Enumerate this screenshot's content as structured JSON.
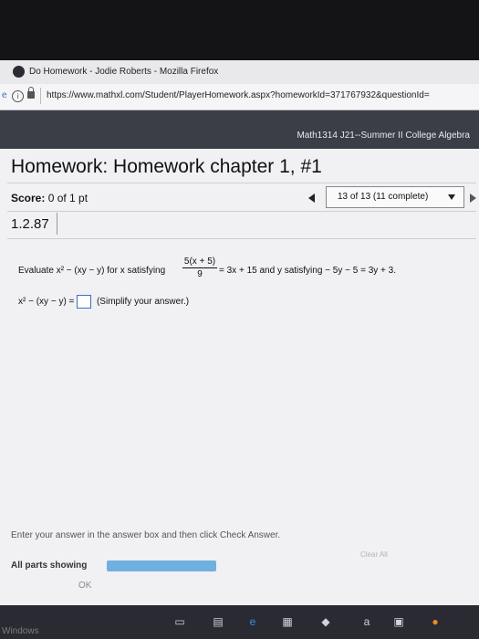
{
  "browser": {
    "window_title": "Do Homework - Jodie Roberts - Mozilla Firefox",
    "url_left_fragment": "e",
    "url": "https://www.mathxl.com/Student/PlayerHomework.aspx?homeworkId=371767932&questionId="
  },
  "course": {
    "name": "Math1314 J21--Summer II College Algebra"
  },
  "homework": {
    "title": "Homework: Homework chapter 1, #1",
    "score_label": "Score:",
    "score_value": "0 of 1 pt",
    "nav_status": "13 of 13 (11 complete)",
    "section": "1.2.87"
  },
  "question": {
    "prefix": "Evaluate x² − (xy − y) for x satisfying",
    "fraction_num": "5(x + 5)",
    "fraction_den": "9",
    "suffix": "= 3x + 15 and y satisfying − 5y − 5 = 3y + 3.",
    "answer_prefix": "x² − (xy − y) =",
    "answer_value": "",
    "answer_hint": "(Simplify your answer.)"
  },
  "footer": {
    "instruction": "Enter your answer in the answer box and then click Check Answer.",
    "parts_label": "All parts showing",
    "parts_progress": 1.0,
    "clear_all": "Clear All",
    "ok": "OK"
  },
  "taskbar": {
    "windows_label": "Windows"
  },
  "colors": {
    "link": "#3a6fc9",
    "progress": "#6fb0e0"
  }
}
